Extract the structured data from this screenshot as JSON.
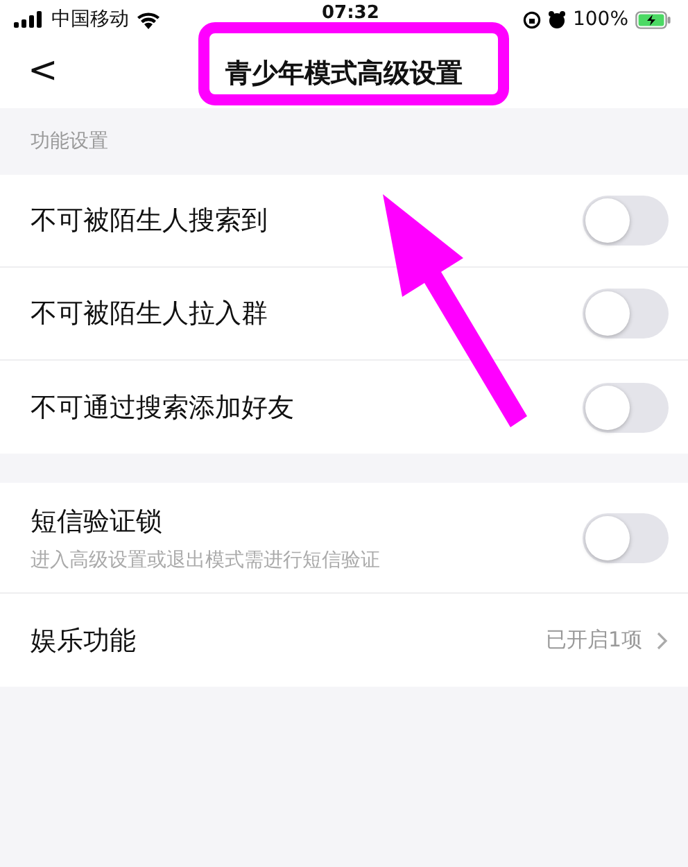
{
  "status_bar": {
    "carrier": "中国移动",
    "time": "07:32",
    "battery": "100%"
  },
  "header": {
    "back": "<",
    "title": "青少年模式高级设置"
  },
  "sections": [
    {
      "title": "功能设置",
      "rows": [
        {
          "kind": "toggle",
          "label": "不可被陌生人搜索到",
          "on": false
        },
        {
          "kind": "toggle",
          "label": "不可被陌生人拉入群",
          "on": false
        },
        {
          "kind": "toggle",
          "label": "不可通过搜索添加好友",
          "on": false
        }
      ]
    },
    {
      "rows": [
        {
          "kind": "toggle",
          "label": "短信验证锁",
          "hint": "进入高级设置或退出模式需进行短信验证",
          "on": false
        },
        {
          "kind": "link",
          "label": "娱乐功能",
          "value": "已开启1项"
        }
      ]
    }
  ]
}
